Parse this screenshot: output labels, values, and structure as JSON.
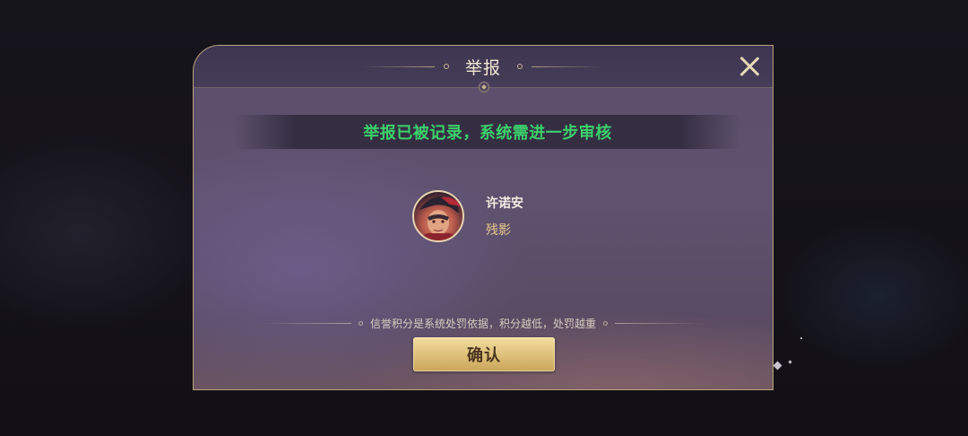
{
  "dialog": {
    "title": "举报",
    "close_icon": "close-icon"
  },
  "banner": {
    "message": "举报已被记录，系统需进一步审核"
  },
  "reported_user": {
    "name": "许诺安",
    "hero": "残影",
    "avatar_icon": "hero-avatar"
  },
  "notice": {
    "text": "信誉积分是系统处罚依据，积分越低，处罚越重"
  },
  "actions": {
    "confirm_label": "确认"
  },
  "colors": {
    "success_text": "#3bd16b",
    "hero_text": "#e7c98b",
    "button_gold": "#ddbf76",
    "frame_gold": "#b9a27a"
  }
}
